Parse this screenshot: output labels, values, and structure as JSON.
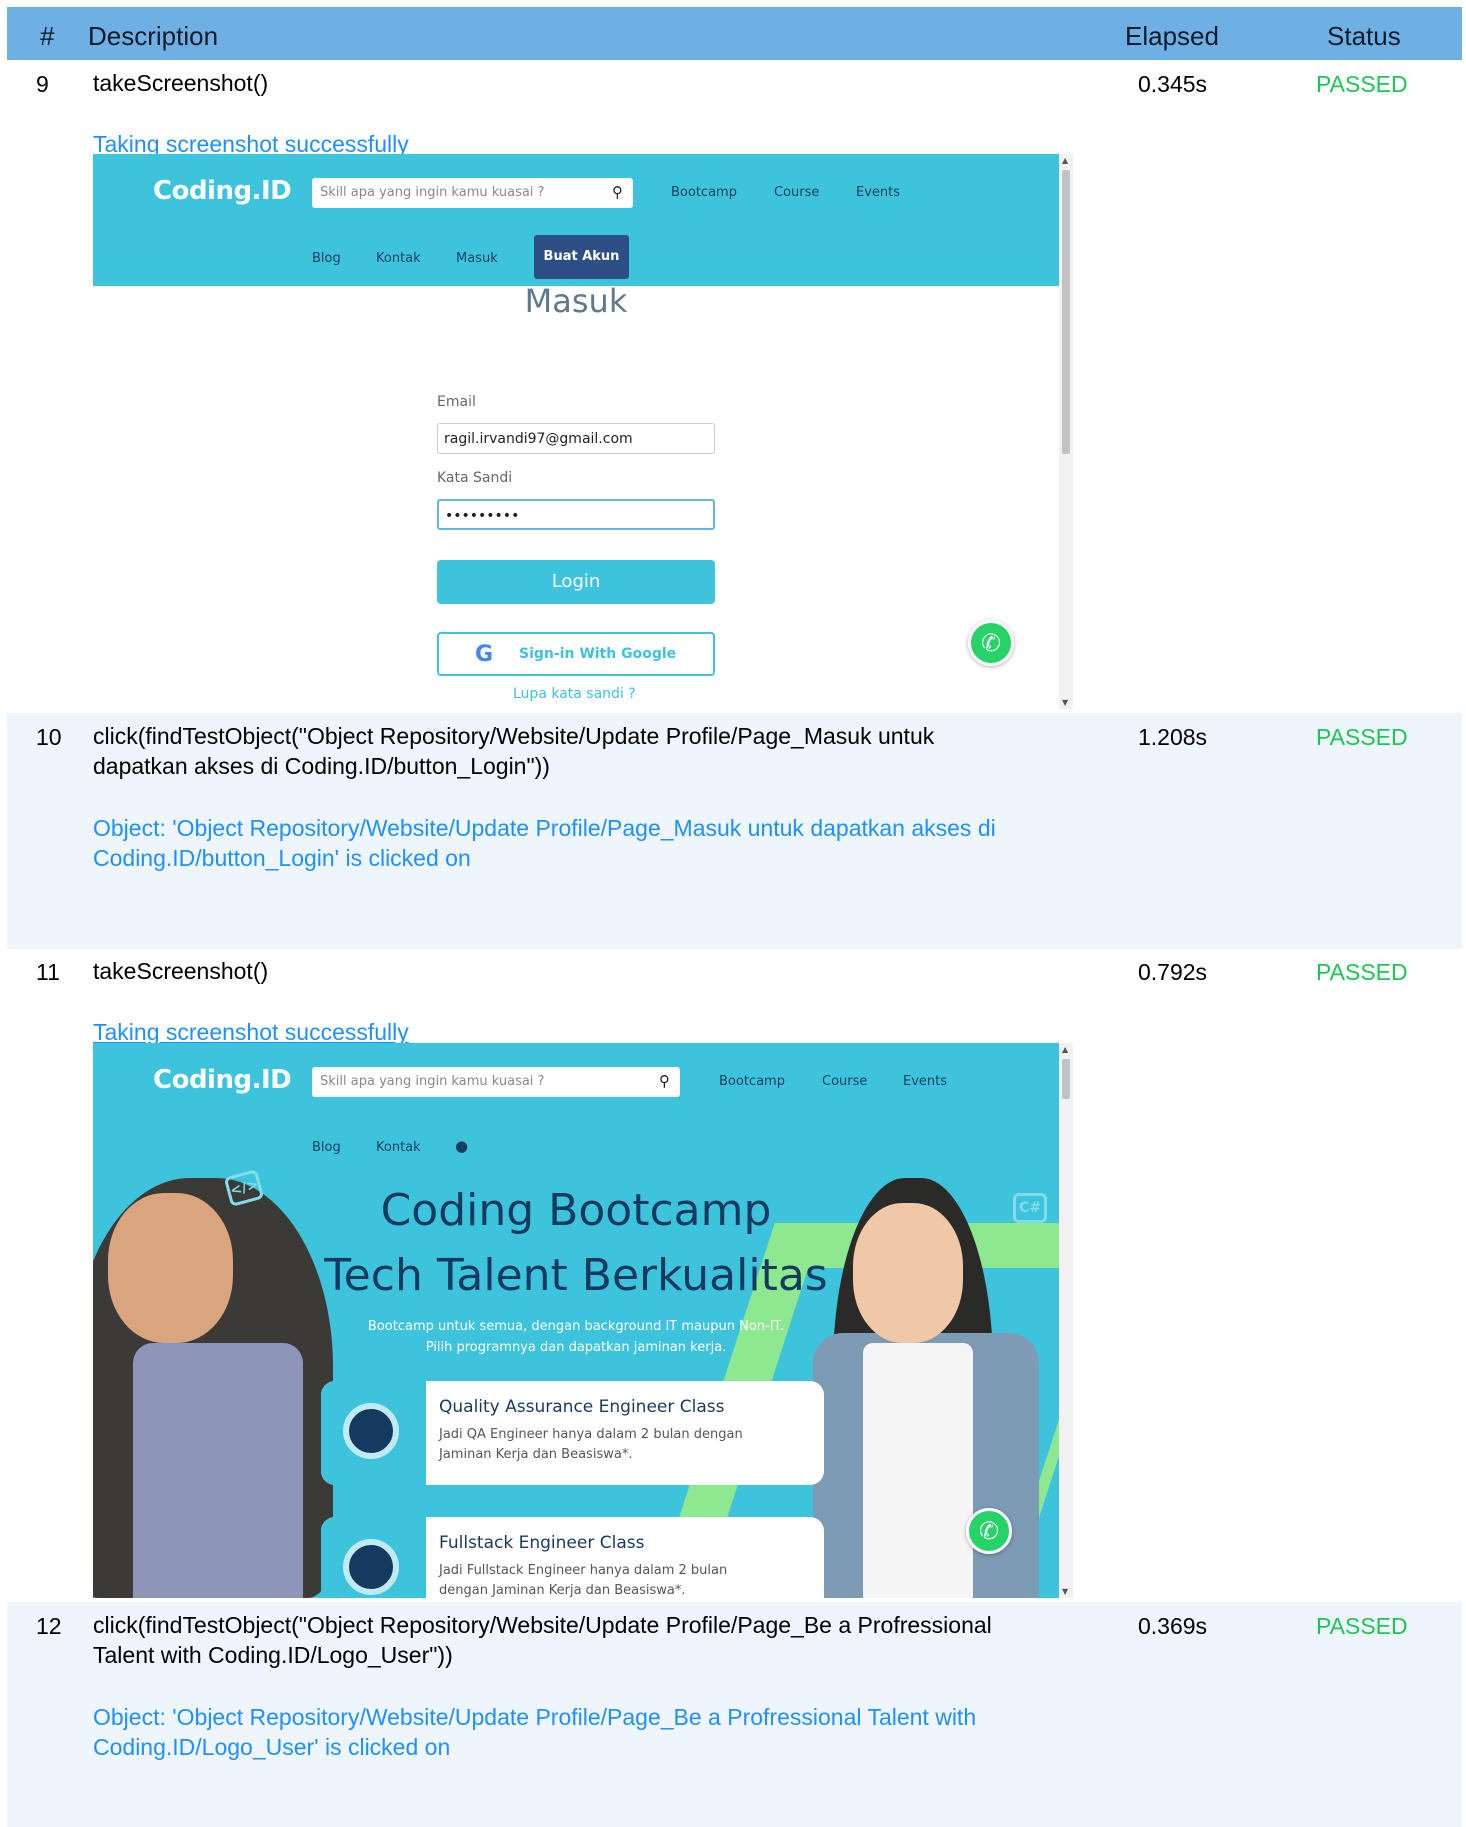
{
  "header": {
    "num": "#",
    "description": "Description",
    "elapsed": "Elapsed",
    "status": "Status"
  },
  "rows": [
    {
      "num": "9",
      "description": "takeScreenshot()",
      "elapsed": "0.345s",
      "status": "PASSED",
      "message": "Taking screenshot successfully"
    },
    {
      "num": "10",
      "description_line1": "click(findTestObject(\"Object Repository/Website/Update Profile/Page_Masuk untuk",
      "description_line2": "dapatkan akses di Coding.ID/button_Login\"))",
      "elapsed": "1.208s",
      "status": "PASSED",
      "message_line1": "Object: 'Object Repository/Website/Update Profile/Page_Masuk untuk dapatkan akses di",
      "message_line2": "Coding.ID/button_Login' is clicked on"
    },
    {
      "num": "11",
      "description": "takeScreenshot()",
      "elapsed": "0.792s",
      "status": "PASSED",
      "message": "Taking screenshot successfully"
    },
    {
      "num": "12",
      "description_line1": "click(findTestObject(\"Object Repository/Website/Update Profile/Page_Be a Profressional",
      "description_line2": "Talent with Coding.ID/Logo_User\"))",
      "elapsed": "0.369s",
      "status": "PASSED",
      "message_line1": "Object: 'Object Repository/Website/Update Profile/Page_Be a Profressional Talent with",
      "message_line2": "Coding.ID/Logo_User' is clicked on"
    }
  ],
  "screenshot1": {
    "logo": "Coding.ID",
    "search_placeholder": "Skill apa yang ingin kamu kuasai ?",
    "nav": [
      "Bootcamp",
      "Course",
      "Events",
      "Blog",
      "Kontak",
      "Masuk"
    ],
    "buat_akun": "Buat Akun",
    "page_title": "Masuk",
    "email_label": "Email",
    "email_value": "ragil.irvandi97@gmail.com",
    "password_label": "Kata Sandi",
    "password_value": "•••••••••",
    "login_button": "Login",
    "google_button": "Sign-in With Google",
    "forgot": "Lupa kata sandi ?"
  },
  "screenshot2": {
    "logo": "Coding.ID",
    "search_placeholder": "Skill apa yang ingin kamu kuasai ?",
    "nav": [
      "Bootcamp",
      "Course",
      "Events",
      "Blog",
      "Kontak"
    ],
    "hero_title_1": "Coding Bootcamp",
    "hero_title_2": "Tech Talent Berkualitas",
    "hero_sub_1": "Bootcamp untuk semua, dengan background IT maupun Non-IT.",
    "hero_sub_2": "Pilih programnya dan dapatkan jaminan kerja.",
    "card1_title": "Quality Assurance Engineer Class",
    "card1_line1": "Jadi QA Engineer hanya dalam 2 bulan dengan",
    "card1_line2": "Jaminan Kerja dan Beasiswa*.",
    "card2_title": "Fullstack Engineer Class",
    "card2_line1": "Jadi Fullstack Engineer hanya dalam 2 bulan",
    "card2_line2": "dengan Jaminan Kerja dan Beasiswa*.",
    "deco_left": "</>",
    "deco_right": "C#"
  },
  "colors": {
    "header_bg": "#6fb0e4",
    "row_alt_bg": "#eef5fd",
    "passed": "#1fc556",
    "message": "#1e90ff",
    "site_primary": "#3ec3dc",
    "site_dark": "#2d4f86"
  }
}
